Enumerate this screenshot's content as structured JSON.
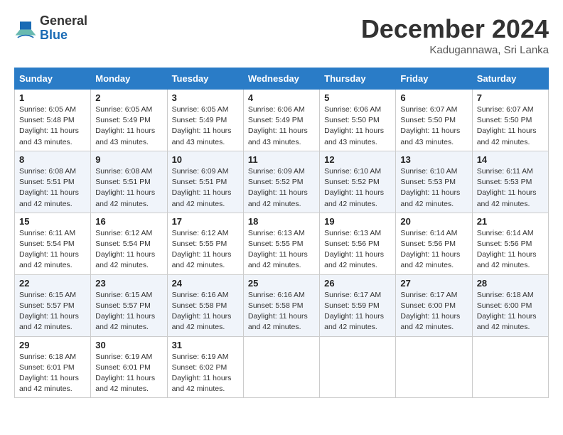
{
  "header": {
    "logo_general": "General",
    "logo_blue": "Blue",
    "month_title": "December 2024",
    "location": "Kadugannawa, Sri Lanka"
  },
  "weekdays": [
    "Sunday",
    "Monday",
    "Tuesday",
    "Wednesday",
    "Thursday",
    "Friday",
    "Saturday"
  ],
  "weeks": [
    [
      {
        "day": "1",
        "sunrise": "6:05 AM",
        "sunset": "5:48 PM",
        "daylight": "11 hours and 43 minutes."
      },
      {
        "day": "2",
        "sunrise": "6:05 AM",
        "sunset": "5:49 PM",
        "daylight": "11 hours and 43 minutes."
      },
      {
        "day": "3",
        "sunrise": "6:05 AM",
        "sunset": "5:49 PM",
        "daylight": "11 hours and 43 minutes."
      },
      {
        "day": "4",
        "sunrise": "6:06 AM",
        "sunset": "5:49 PM",
        "daylight": "11 hours and 43 minutes."
      },
      {
        "day": "5",
        "sunrise": "6:06 AM",
        "sunset": "5:50 PM",
        "daylight": "11 hours and 43 minutes."
      },
      {
        "day": "6",
        "sunrise": "6:07 AM",
        "sunset": "5:50 PM",
        "daylight": "11 hours and 43 minutes."
      },
      {
        "day": "7",
        "sunrise": "6:07 AM",
        "sunset": "5:50 PM",
        "daylight": "11 hours and 42 minutes."
      }
    ],
    [
      {
        "day": "8",
        "sunrise": "6:08 AM",
        "sunset": "5:51 PM",
        "daylight": "11 hours and 42 minutes."
      },
      {
        "day": "9",
        "sunrise": "6:08 AM",
        "sunset": "5:51 PM",
        "daylight": "11 hours and 42 minutes."
      },
      {
        "day": "10",
        "sunrise": "6:09 AM",
        "sunset": "5:51 PM",
        "daylight": "11 hours and 42 minutes."
      },
      {
        "day": "11",
        "sunrise": "6:09 AM",
        "sunset": "5:52 PM",
        "daylight": "11 hours and 42 minutes."
      },
      {
        "day": "12",
        "sunrise": "6:10 AM",
        "sunset": "5:52 PM",
        "daylight": "11 hours and 42 minutes."
      },
      {
        "day": "13",
        "sunrise": "6:10 AM",
        "sunset": "5:53 PM",
        "daylight": "11 hours and 42 minutes."
      },
      {
        "day": "14",
        "sunrise": "6:11 AM",
        "sunset": "5:53 PM",
        "daylight": "11 hours and 42 minutes."
      }
    ],
    [
      {
        "day": "15",
        "sunrise": "6:11 AM",
        "sunset": "5:54 PM",
        "daylight": "11 hours and 42 minutes."
      },
      {
        "day": "16",
        "sunrise": "6:12 AM",
        "sunset": "5:54 PM",
        "daylight": "11 hours and 42 minutes."
      },
      {
        "day": "17",
        "sunrise": "6:12 AM",
        "sunset": "5:55 PM",
        "daylight": "11 hours and 42 minutes."
      },
      {
        "day": "18",
        "sunrise": "6:13 AM",
        "sunset": "5:55 PM",
        "daylight": "11 hours and 42 minutes."
      },
      {
        "day": "19",
        "sunrise": "6:13 AM",
        "sunset": "5:56 PM",
        "daylight": "11 hours and 42 minutes."
      },
      {
        "day": "20",
        "sunrise": "6:14 AM",
        "sunset": "5:56 PM",
        "daylight": "11 hours and 42 minutes."
      },
      {
        "day": "21",
        "sunrise": "6:14 AM",
        "sunset": "5:56 PM",
        "daylight": "11 hours and 42 minutes."
      }
    ],
    [
      {
        "day": "22",
        "sunrise": "6:15 AM",
        "sunset": "5:57 PM",
        "daylight": "11 hours and 42 minutes."
      },
      {
        "day": "23",
        "sunrise": "6:15 AM",
        "sunset": "5:57 PM",
        "daylight": "11 hours and 42 minutes."
      },
      {
        "day": "24",
        "sunrise": "6:16 AM",
        "sunset": "5:58 PM",
        "daylight": "11 hours and 42 minutes."
      },
      {
        "day": "25",
        "sunrise": "6:16 AM",
        "sunset": "5:58 PM",
        "daylight": "11 hours and 42 minutes."
      },
      {
        "day": "26",
        "sunrise": "6:17 AM",
        "sunset": "5:59 PM",
        "daylight": "11 hours and 42 minutes."
      },
      {
        "day": "27",
        "sunrise": "6:17 AM",
        "sunset": "6:00 PM",
        "daylight": "11 hours and 42 minutes."
      },
      {
        "day": "28",
        "sunrise": "6:18 AM",
        "sunset": "6:00 PM",
        "daylight": "11 hours and 42 minutes."
      }
    ],
    [
      {
        "day": "29",
        "sunrise": "6:18 AM",
        "sunset": "6:01 PM",
        "daylight": "11 hours and 42 minutes."
      },
      {
        "day": "30",
        "sunrise": "6:19 AM",
        "sunset": "6:01 PM",
        "daylight": "11 hours and 42 minutes."
      },
      {
        "day": "31",
        "sunrise": "6:19 AM",
        "sunset": "6:02 PM",
        "daylight": "11 hours and 42 minutes."
      },
      null,
      null,
      null,
      null
    ]
  ],
  "labels": {
    "sunrise": "Sunrise:",
    "sunset": "Sunset:",
    "daylight": "Daylight:"
  }
}
